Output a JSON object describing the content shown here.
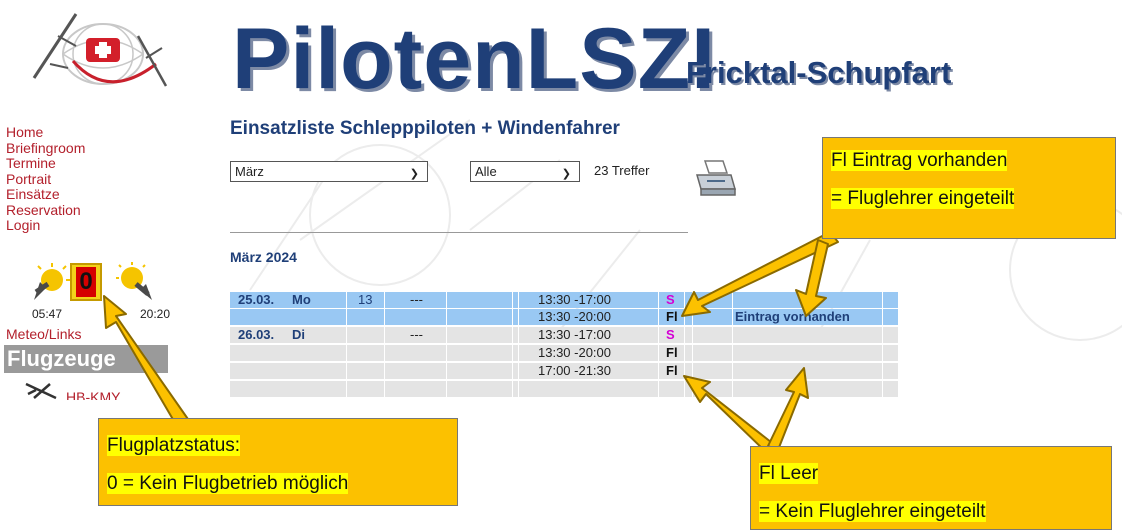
{
  "site": {
    "brand": "PilotenLSZI",
    "brand_sub": "Fricktal-Schupfart"
  },
  "nav": {
    "items": [
      "Home",
      "Briefingroom",
      "Termine",
      "Portrait",
      "Einsätze",
      "Reservation",
      "Login"
    ],
    "meteo": "Meteo/Links"
  },
  "status": {
    "airfield_value": "0",
    "sunrise": "05:47",
    "sunset": "20:20"
  },
  "sidebar": {
    "section_title": "Flugzeuge",
    "aircraft": "HB-KMY"
  },
  "main": {
    "title": "Einsatzliste Schlepppiloten + Windenfahrer",
    "month_select": "März",
    "filter_select": "Alle",
    "hits": "23 Treffer",
    "month_heading": "März 2024"
  },
  "table": {
    "rows": [
      {
        "date": "25.03.",
        "weekday": "Mo",
        "num": "13",
        "dash": "---",
        "time": "13:30 -17:00",
        "flag": "S",
        "entry": ""
      },
      {
        "date": "",
        "weekday": "",
        "num": "",
        "dash": "",
        "time": "13:30 -20:00",
        "flag": "Fl",
        "entry": "Eintrag vorhanden"
      },
      {
        "date": "26.03.",
        "weekday": "Di",
        "num": "",
        "dash": "---",
        "time": "13:30 -17:00",
        "flag": "S",
        "entry": ""
      },
      {
        "date": "",
        "weekday": "",
        "num": "",
        "dash": "",
        "time": "13:30 -20:00",
        "flag": "Fl",
        "entry": ""
      },
      {
        "date": "",
        "weekday": "",
        "num": "",
        "dash": "",
        "time": "17:00 -21:30",
        "flag": "Fl",
        "entry": ""
      }
    ]
  },
  "annotations": {
    "fl_present": {
      "line1": "Fl Eintrag vorhanden",
      "line2": "= Fluglehrer eingeteilt"
    },
    "airfield": {
      "line1": "Flugplatzstatus:",
      "line2": "0 = Kein Flugbetrieb möglich"
    },
    "fl_empty": {
      "line1": "Fl Leer",
      "line2": "= Kein Fluglehrer eingeteilt"
    }
  },
  "colors": {
    "brand_blue": "#1f3f78",
    "nav_red": "#b3202c",
    "row_highlight": "#99c8f3",
    "row_grey": "#e4e4e4",
    "callout_fill": "#fcc100",
    "text_highlight": "#ffff00",
    "s_flag": "#d400d4"
  },
  "icons": [
    "logo-emblem",
    "sunrise-icon",
    "sunset-icon",
    "printer-icon",
    "plane-icon",
    "arrow"
  ]
}
